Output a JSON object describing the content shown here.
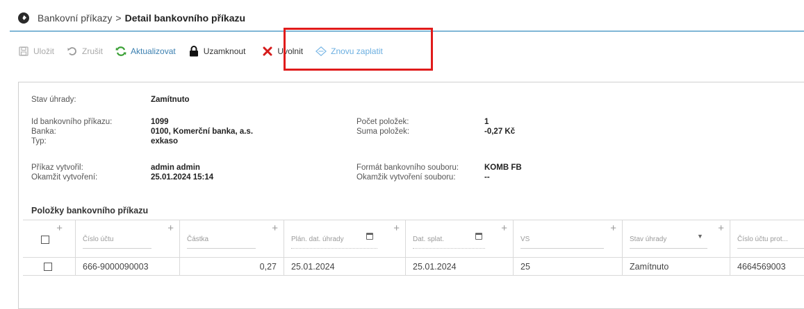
{
  "breadcrumb": {
    "parent": "Bankovní příkazy",
    "separator": ">",
    "current": "Detail bankovního příkazu"
  },
  "toolbar": {
    "save": "Uložit",
    "cancel": "Zrušit",
    "refresh": "Aktualizovat",
    "lock": "Uzamknout",
    "release": "Uvolnit",
    "repay": "Znovu zaplatit"
  },
  "detail": {
    "status_label": "Stav úhrady:",
    "status_value": "Zamítnuto",
    "id_label": "Id bankovního příkazu:",
    "id_value": "1099",
    "bank_label": "Banka:",
    "bank_value": "0100, Komerční banka, a.s.",
    "type_label": "Typ:",
    "type_value": "exkaso",
    "count_label": "Počet položek:",
    "count_value": "1",
    "sum_label": "Suma položek:",
    "sum_value": "-0,27 Kč",
    "created_by_label": "Příkaz vytvořil:",
    "created_by_value": "admin admin",
    "created_at_label": "Okamžit vytvoření:",
    "created_at_value": "25.01.2024 15:14",
    "format_label": "Formát bankovního souboru:",
    "format_value": "KOMB FB",
    "file_created_label": "Okamžik vytvoření souboru:",
    "file_created_value": "--"
  },
  "items_section": {
    "title": "Položky bankovního příkazu",
    "columns": [
      "Číslo účtu",
      "Částka",
      "Plán. dat. úhrady",
      "Dat. splat.",
      "VS",
      "Stav úhrady",
      "Číslo účtu prot..."
    ],
    "rows": [
      {
        "account": "666-9000090003",
        "amount": "0,27",
        "planned_date": "25.01.2024",
        "due_date": "25.01.2024",
        "vs": "25",
        "status": "Zamítnuto",
        "counter_account": "4664569003"
      }
    ]
  },
  "icons": {
    "save": "floppy-icon",
    "cancel": "undo-icon",
    "refresh": "refresh-icon",
    "lock": "lock-icon",
    "release": "x-icon",
    "repay": "diamond-icon"
  },
  "colors": {
    "highlight_border": "#e01b1b",
    "release_icon": "#d51b1b",
    "refresh_icon": "#3aa035",
    "repay_text": "#6aaee0",
    "title_underline": "#7fb6d6"
  }
}
